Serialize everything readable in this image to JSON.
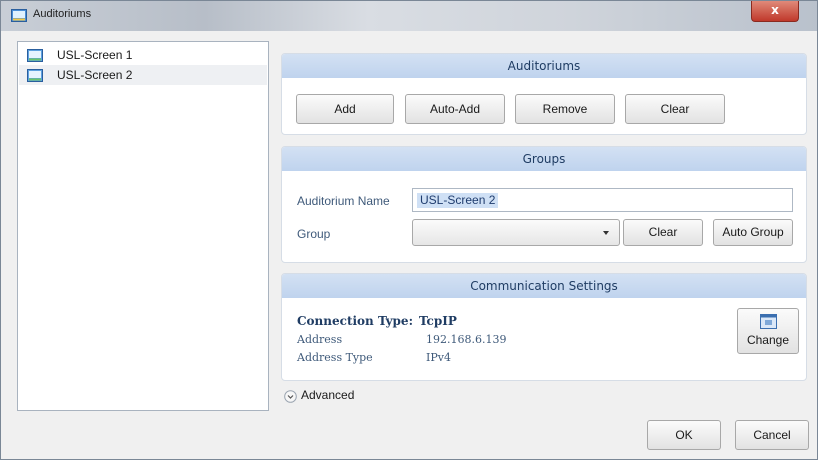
{
  "window": {
    "title": "Auditoriums",
    "close_label": "x"
  },
  "list": {
    "items": [
      {
        "label": "USL-Screen  1",
        "selected": false
      },
      {
        "label": "USL-Screen  2",
        "selected": true
      }
    ]
  },
  "auditoriums": {
    "header": "Auditoriums",
    "buttons": {
      "add": "Add",
      "auto_add": "Auto-Add",
      "remove": "Remove",
      "clear": "Clear"
    }
  },
  "groups": {
    "header": "Groups",
    "auditorium_name_label": "Auditorium Name",
    "auditorium_name_value": "USL-Screen  2",
    "group_label": "Group",
    "group_value": "",
    "clear_label": "Clear",
    "auto_group_label": "Auto Group"
  },
  "communication": {
    "header": "Communication Settings",
    "connection_type_label": "Connection Type:",
    "connection_type_value": "TcpIP",
    "address_label": "Address",
    "address_value": "192.168.6.139",
    "address_type_label": "Address Type",
    "address_type_value": "IPv4",
    "change_label": "Change"
  },
  "advanced": {
    "label": "Advanced"
  },
  "footer": {
    "ok_label": "OK",
    "cancel_label": "Cancel"
  }
}
